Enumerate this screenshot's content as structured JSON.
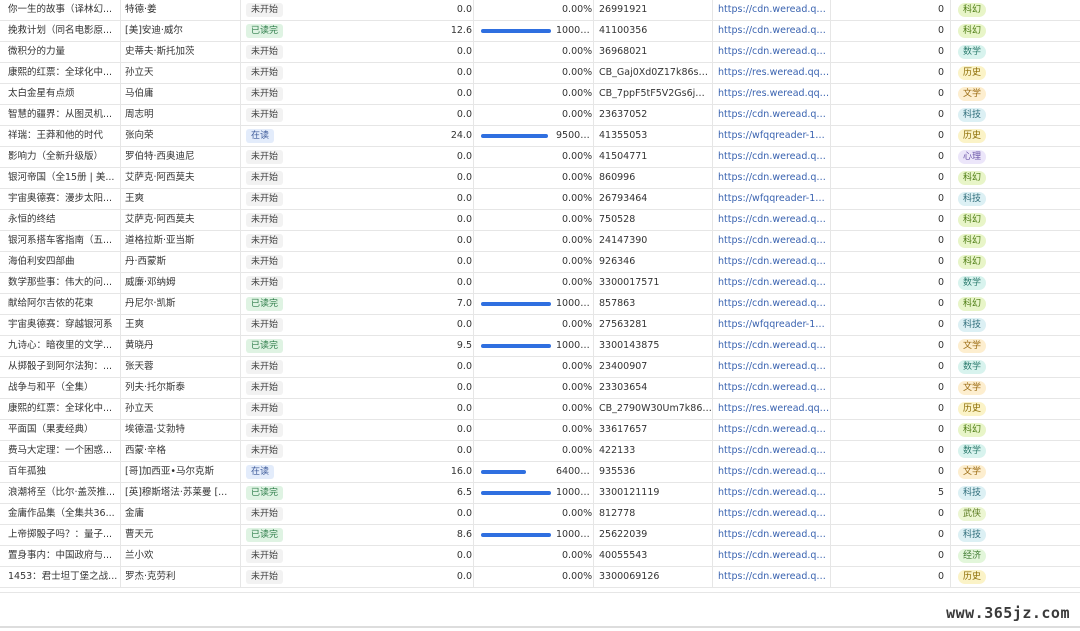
{
  "rows": [
    {
      "title": "你一生的故事（译林幻...",
      "author": "特德·姜",
      "status": "未开始",
      "status_kind": "todo",
      "hours": "0.0",
      "progress": 0,
      "progress_text": "0.00%",
      "book_id": "26991921",
      "url": "https://cdn.weread.qq.c...",
      "notes": "0",
      "category": "科幻"
    },
    {
      "title": "挽救计划（同名电影原...",
      "author": "[美]安迪·威尔",
      "status": "已读完",
      "status_kind": "done",
      "hours": "12.6",
      "progress": 1,
      "progress_text": "10000...",
      "book_id": "41100356",
      "url": "https://cdn.weread.qq.c...",
      "notes": "0",
      "category": "科幻"
    },
    {
      "title": "微积分的力量",
      "author": "史蒂夫·斯托加茨",
      "status": "未开始",
      "status_kind": "todo",
      "hours": "0.0",
      "progress": 0,
      "progress_text": "0.00%",
      "book_id": "36968021",
      "url": "https://cdn.weread.qq.c...",
      "notes": "0",
      "category": "数学"
    },
    {
      "title": "康熙的红票：全球化中...",
      "author": "孙立天",
      "status": "未开始",
      "status_kind": "todo",
      "hours": "0.0",
      "progress": 0,
      "progress_text": "0.00%",
      "book_id": "CB_Gaj0Xd0Z17k86sS6s...",
      "url": "https://res.weread.qq.c...",
      "notes": "0",
      "category": "历史"
    },
    {
      "title": "太白金星有点烦",
      "author": "马伯庸",
      "status": "未开始",
      "status_kind": "todo",
      "hours": "0.0",
      "progress": 0,
      "progress_text": "0.00%",
      "book_id": "CB_7ppF5tF5V2Gs6jW6...",
      "url": "https://res.weread.qq.c...",
      "notes": "0",
      "category": "文学"
    },
    {
      "title": "智慧的疆界：从图灵机...",
      "author": "周志明",
      "status": "未开始",
      "status_kind": "todo",
      "hours": "0.0",
      "progress": 0,
      "progress_text": "0.00%",
      "book_id": "23637052",
      "url": "https://cdn.weread.qq.c...",
      "notes": "0",
      "category": "科技"
    },
    {
      "title": "祥瑞：王莽和他的时代",
      "author": "张向荣",
      "status": "在读",
      "status_kind": "reading",
      "hours": "24.0",
      "progress": 0.95,
      "progress_text": "9500....",
      "book_id": "41355053",
      "url": "https://wfqqreader-125...",
      "notes": "0",
      "category": "历史"
    },
    {
      "title": "影响力（全新升级版）",
      "author": "罗伯特·西奥迪尼",
      "status": "未开始",
      "status_kind": "todo",
      "hours": "0.0",
      "progress": 0,
      "progress_text": "0.00%",
      "book_id": "41504771",
      "url": "https://cdn.weread.qq.c...",
      "notes": "0",
      "category": "心理"
    },
    {
      "title": "银河帝国（全15册 | 美...",
      "author": "艾萨克·阿西莫夫",
      "status": "未开始",
      "status_kind": "todo",
      "hours": "0.0",
      "progress": 0,
      "progress_text": "0.00%",
      "book_id": "860996",
      "url": "https://cdn.weread.qq.c...",
      "notes": "0",
      "category": "科幻"
    },
    {
      "title": "宇宙奥德赛：漫步太阳...",
      "author": "王爽",
      "status": "未开始",
      "status_kind": "todo",
      "hours": "0.0",
      "progress": 0,
      "progress_text": "0.00%",
      "book_id": "26793464",
      "url": "https://wfqqreader-125...",
      "notes": "0",
      "category": "科技"
    },
    {
      "title": "永恒的终结",
      "author": "艾萨克·阿西莫夫",
      "status": "未开始",
      "status_kind": "todo",
      "hours": "0.0",
      "progress": 0,
      "progress_text": "0.00%",
      "book_id": "750528",
      "url": "https://cdn.weread.qq.c...",
      "notes": "0",
      "category": "科幻"
    },
    {
      "title": "银河系搭车客指南（五...",
      "author": "道格拉斯·亚当斯",
      "status": "未开始",
      "status_kind": "todo",
      "hours": "0.0",
      "progress": 0,
      "progress_text": "0.00%",
      "book_id": "24147390",
      "url": "https://cdn.weread.qq.c...",
      "notes": "0",
      "category": "科幻"
    },
    {
      "title": "海伯利安四部曲",
      "author": "丹·西蒙斯",
      "status": "未开始",
      "status_kind": "todo",
      "hours": "0.0",
      "progress": 0,
      "progress_text": "0.00%",
      "book_id": "926346",
      "url": "https://cdn.weread.qq.c...",
      "notes": "0",
      "category": "科幻"
    },
    {
      "title": "数学那些事：伟大的问...",
      "author": "威廉·邓纳姆",
      "status": "未开始",
      "status_kind": "todo",
      "hours": "0.0",
      "progress": 0,
      "progress_text": "0.00%",
      "book_id": "3300017571",
      "url": "https://cdn.weread.qq.c...",
      "notes": "0",
      "category": "数学"
    },
    {
      "title": "献给阿尔吉侬的花束",
      "author": "丹尼尔·凯斯",
      "status": "已读完",
      "status_kind": "done",
      "hours": "7.0",
      "progress": 1,
      "progress_text": "10000...",
      "book_id": "857863",
      "url": "https://cdn.weread.qq.c...",
      "notes": "0",
      "category": "科幻"
    },
    {
      "title": "宇宙奥德赛：穿越银河系",
      "author": "王爽",
      "status": "未开始",
      "status_kind": "todo",
      "hours": "0.0",
      "progress": 0,
      "progress_text": "0.00%",
      "book_id": "27563281",
      "url": "https://wfqqreader-125...",
      "notes": "0",
      "category": "科技"
    },
    {
      "title": "九诗心：暗夜里的文学...",
      "author": "黄晓丹",
      "status": "已读完",
      "status_kind": "done",
      "hours": "9.5",
      "progress": 1,
      "progress_text": "10000...",
      "book_id": "3300143875",
      "url": "https://cdn.weread.qq.c...",
      "notes": "0",
      "category": "文学"
    },
    {
      "title": "从掷骰子到阿尔法狗：...",
      "author": "张天蓉",
      "status": "未开始",
      "status_kind": "todo",
      "hours": "0.0",
      "progress": 0,
      "progress_text": "0.00%",
      "book_id": "23400907",
      "url": "https://cdn.weread.qq.c...",
      "notes": "0",
      "category": "数学"
    },
    {
      "title": "战争与和平（全集）",
      "author": "列夫·托尔斯泰",
      "status": "未开始",
      "status_kind": "todo",
      "hours": "0.0",
      "progress": 0,
      "progress_text": "0.00%",
      "book_id": "23303654",
      "url": "https://cdn.weread.qq.c...",
      "notes": "0",
      "category": "文学"
    },
    {
      "title": "康熙的红票：全球化中...",
      "author": "孙立天",
      "status": "未开始",
      "status_kind": "todo",
      "hours": "0.0",
      "progress": 0,
      "progress_text": "0.00%",
      "book_id": "CB_2790W30Um7k86sS...",
      "url": "https://res.weread.qq.c...",
      "notes": "0",
      "category": "历史"
    },
    {
      "title": "平面国（果麦经典）",
      "author": "埃德温·艾勃特",
      "status": "未开始",
      "status_kind": "todo",
      "hours": "0.0",
      "progress": 0,
      "progress_text": "0.00%",
      "book_id": "33617657",
      "url": "https://cdn.weread.qq.c...",
      "notes": "0",
      "category": "科幻"
    },
    {
      "title": "费马大定理：一个困惑...",
      "author": "西蒙·辛格",
      "status": "未开始",
      "status_kind": "todo",
      "hours": "0.0",
      "progress": 0,
      "progress_text": "0.00%",
      "book_id": "422133",
      "url": "https://cdn.weread.qq.c...",
      "notes": "0",
      "category": "数学"
    },
    {
      "title": "百年孤独",
      "author": "[哥]加西亚•马尔克斯",
      "status": "在读",
      "status_kind": "reading",
      "hours": "16.0",
      "progress": 0.64,
      "progress_text": "6400....",
      "book_id": "935536",
      "url": "https://cdn.weread.qq.c...",
      "notes": "0",
      "category": "文学"
    },
    {
      "title": "浪潮将至（比尔·盖茨推...",
      "author": "[英]穆斯塔法·苏莱曼 [...",
      "status": "已读完",
      "status_kind": "done",
      "hours": "6.5",
      "progress": 1,
      "progress_text": "10000...",
      "book_id": "3300121119",
      "url": "https://cdn.weread.qq.c...",
      "notes": "5",
      "category": "科技"
    },
    {
      "title": "金庸作品集（全集共36...",
      "author": "金庸",
      "status": "未开始",
      "status_kind": "todo",
      "hours": "0.0",
      "progress": 0,
      "progress_text": "0.00%",
      "book_id": "812778",
      "url": "https://cdn.weread.qq.c...",
      "notes": "0",
      "category": "武侠"
    },
    {
      "title": "上帝掷骰子吗？：量子...",
      "author": "曹天元",
      "status": "已读完",
      "status_kind": "done",
      "hours": "8.6",
      "progress": 1,
      "progress_text": "10000...",
      "book_id": "25622039",
      "url": "https://cdn.weread.qq.c...",
      "notes": "0",
      "category": "科技"
    },
    {
      "title": "置身事内：中国政府与...",
      "author": "兰小欢",
      "status": "未开始",
      "status_kind": "todo",
      "hours": "0.0",
      "progress": 0,
      "progress_text": "0.00%",
      "book_id": "40055543",
      "url": "https://cdn.weread.qq.c...",
      "notes": "0",
      "category": "经济"
    },
    {
      "title": "1453：君士坦丁堡之战...",
      "author": "罗杰·克劳利",
      "status": "未开始",
      "status_kind": "todo",
      "hours": "0.0",
      "progress": 0,
      "progress_text": "0.00%",
      "book_id": "3300069126",
      "url": "https://cdn.weread.qq.c...",
      "notes": "0",
      "category": "历史"
    }
  ],
  "category_colors": {
    "科幻": {
      "bg": "#e8f5c8",
      "fg": "#4a7a10"
    },
    "数学": {
      "bg": "#d8f3ee",
      "fg": "#2f7d70"
    },
    "历史": {
      "bg": "#fbf3c7",
      "fg": "#8a6a00"
    },
    "文学": {
      "bg": "#fdeecf",
      "fg": "#9a6a10"
    },
    "科技": {
      "bg": "#dcf0f4",
      "fg": "#2f6d7a"
    },
    "心理": {
      "bg": "#ece6fa",
      "fg": "#6a55a8"
    },
    "武侠": {
      "bg": "#ecf6d2",
      "fg": "#5a7a20"
    },
    "经济": {
      "bg": "#e2f6da",
      "fg": "#3e7a30"
    }
  },
  "progress_bar_color": "#2f6fe0",
  "watermark": "www.365jz.com"
}
